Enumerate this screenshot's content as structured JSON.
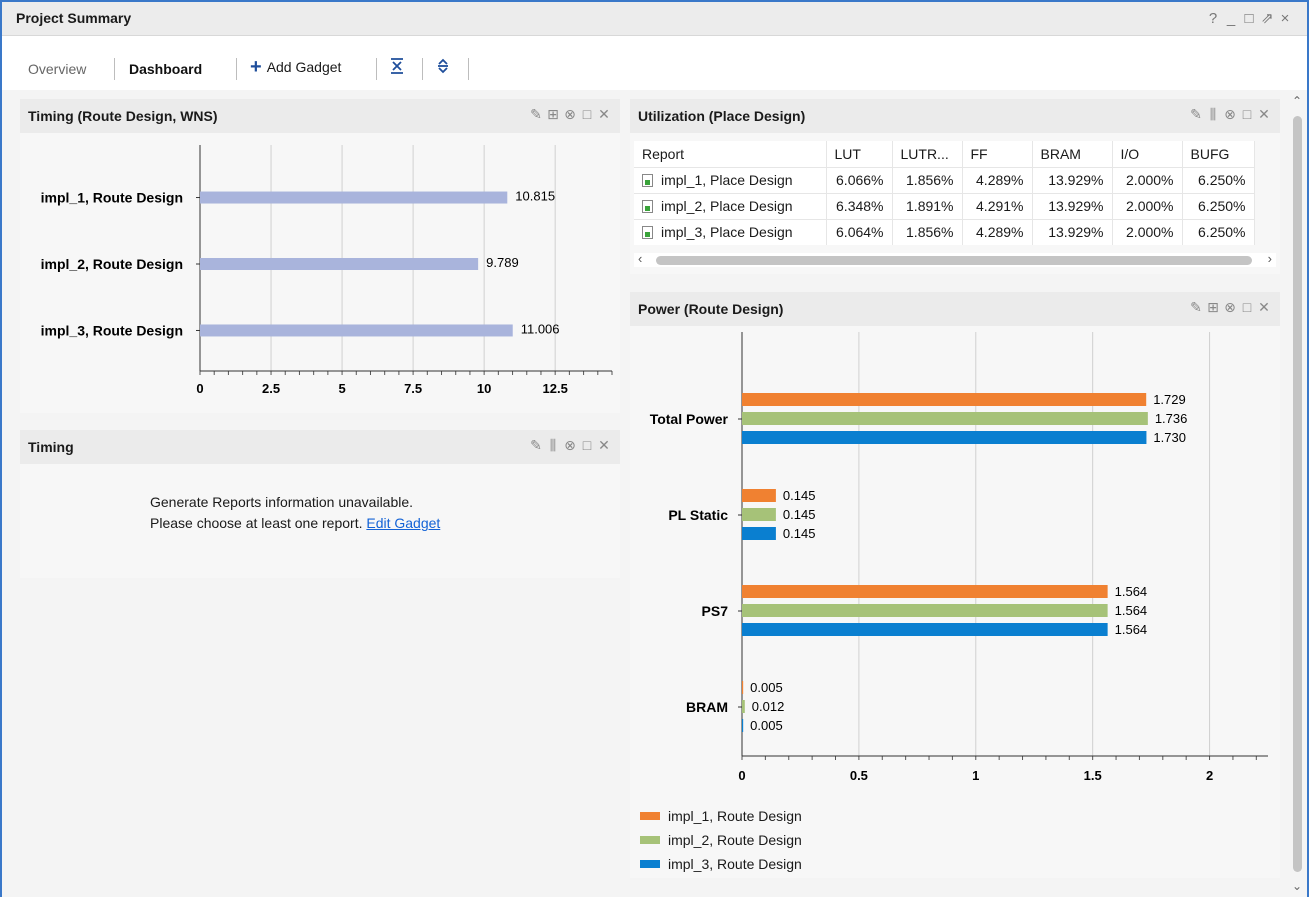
{
  "window": {
    "title": "Project Summary",
    "controls": [
      "?",
      "_",
      "□",
      "⇗",
      "×"
    ]
  },
  "tabs": {
    "overview": "Overview",
    "dashboard": "Dashboard",
    "add_gadget": "Add Gadget"
  },
  "panels": {
    "timing_wns": {
      "title": "Timing (Route Design, WNS)"
    },
    "timing": {
      "title": "Timing",
      "message_line1": "Generate Reports information unavailable.",
      "message_line2": "Please choose at least one report.",
      "link": "Edit Gadget"
    },
    "utilization": {
      "title": "Utilization (Place Design)",
      "columns": [
        "Report",
        "LUT",
        "LUTR...",
        "FF",
        "BRAM",
        "I/O",
        "BUFG"
      ],
      "rows": [
        [
          "impl_1, Place Design",
          "6.066%",
          "1.856%",
          "4.289%",
          "13.929%",
          "2.000%",
          "6.250%"
        ],
        [
          "impl_2, Place Design",
          "6.348%",
          "1.891%",
          "4.291%",
          "13.929%",
          "2.000%",
          "6.250%"
        ],
        [
          "impl_3, Place Design",
          "6.064%",
          "1.856%",
          "4.289%",
          "13.929%",
          "2.000%",
          "6.250%"
        ]
      ]
    },
    "power": {
      "title": "Power (Route Design)",
      "legend": [
        "impl_1, Route Design",
        "impl_2, Route Design",
        "impl_3, Route Design"
      ]
    }
  },
  "colors": {
    "timing_bar": "#a9b4dc",
    "impl_1": "#f08131",
    "impl_2": "#a6c278",
    "impl_3": "#0a7fd0",
    "accent": "#1f4e9b"
  },
  "chart_data": [
    {
      "type": "bar",
      "orientation": "horizontal",
      "categories": [
        "impl_1, Route Design",
        "impl_2, Route Design",
        "impl_3, Route Design"
      ],
      "values": [
        10.815,
        9.789,
        11.006
      ],
      "value_labels": [
        "10.815",
        "9.789",
        "11.006"
      ],
      "xlim": [
        0,
        14.5
      ],
      "xticks": [
        "0",
        "2.5",
        "5",
        "7.5",
        "10",
        "12.5"
      ],
      "grid": true
    },
    {
      "type": "bar",
      "orientation": "horizontal",
      "categories": [
        "Total Power",
        "PL Static",
        "PS7",
        "BRAM"
      ],
      "series": [
        {
          "name": "impl_1, Route Design",
          "values": [
            1.729,
            0.145,
            1.564,
            0.005
          ],
          "labels": [
            "1.729",
            "0.145",
            "1.564",
            "0.005"
          ]
        },
        {
          "name": "impl_2, Route Design",
          "values": [
            1.736,
            0.145,
            1.564,
            0.012
          ],
          "labels": [
            "1.736",
            "0.145",
            "1.564",
            "0.012"
          ]
        },
        {
          "name": "impl_3, Route Design",
          "values": [
            1.73,
            0.145,
            1.564,
            0.005
          ],
          "labels": [
            "1.730",
            "0.145",
            "1.564",
            "0.005"
          ]
        }
      ],
      "xlim": [
        0,
        2.25
      ],
      "xticks": [
        "0",
        "0.5",
        "1",
        "1.5",
        "2"
      ],
      "grid": true,
      "legend": "bottom-left"
    }
  ]
}
